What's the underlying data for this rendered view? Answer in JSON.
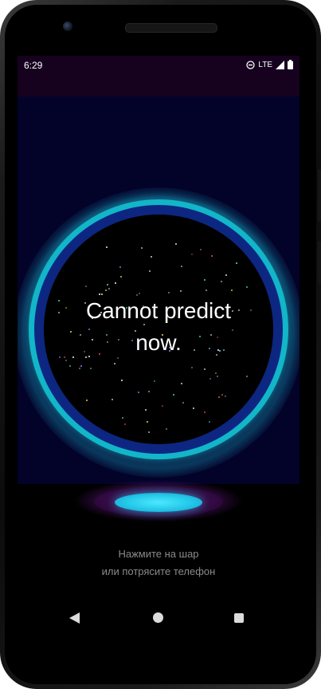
{
  "status_bar": {
    "time": "6:29",
    "network": "LTE",
    "icons": [
      "do-not-disturb-icon",
      "signal-icon",
      "battery-icon"
    ]
  },
  "magic_ball": {
    "answer": "Cannot predict now."
  },
  "hint": {
    "line1": "Нажмите на шар",
    "line2": "или потрясите телефон"
  },
  "nav_bar": {
    "icons": [
      "back-icon",
      "home-icon",
      "recent-apps-icon"
    ]
  },
  "colors": {
    "status_bar_bg": "#16011f",
    "app_bg": "#030229",
    "ball_ring": "#12b6c8",
    "pedestal_top": "#22c7e8",
    "pedestal_glow": "#7a1a9a",
    "hint_text": "#8a8a8a"
  }
}
